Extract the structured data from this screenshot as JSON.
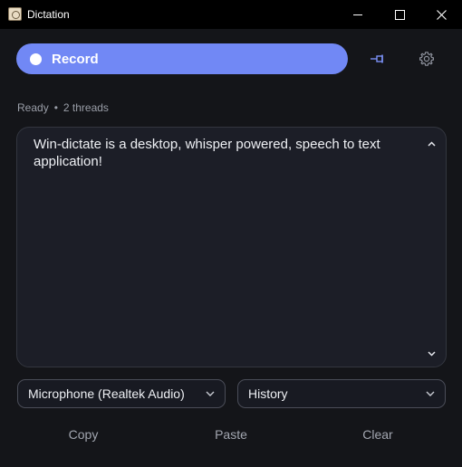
{
  "window": {
    "title": "Dictation",
    "app_icon": "dictation-app-icon",
    "controls": {
      "minimize_icon": "minimize-icon",
      "maximize_icon": "maximize-icon",
      "close_icon": "close-icon"
    }
  },
  "toolbar": {
    "record_label": "Record",
    "record_icon": "record-dot-icon",
    "pin_icon": "pin-icon",
    "settings_icon": "gear-icon"
  },
  "status": {
    "state": "Ready",
    "separator": "•",
    "threads": "2 threads"
  },
  "transcript": {
    "text": "Win-dictate is a desktop, whisper powered, speech to text application!"
  },
  "selectors": {
    "microphone": "Microphone (Realtek Audio)",
    "history": "History"
  },
  "actions": {
    "copy": "Copy",
    "paste": "Paste",
    "clear": "Clear"
  },
  "colors": {
    "accent": "#7188f5",
    "background": "#141519",
    "panel": "#1c1e27",
    "pin": "#7a90f5"
  }
}
